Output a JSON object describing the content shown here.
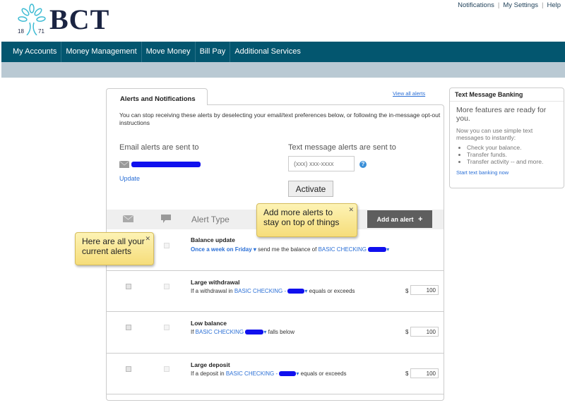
{
  "header": {
    "brand": "BCT",
    "logo_years": [
      "18",
      "71"
    ],
    "top_links": [
      "Notifications",
      "My Settings",
      "Help"
    ]
  },
  "nav": [
    "My Accounts",
    "Money Management",
    "Move Money",
    "Bill Pay",
    "Additional Services"
  ],
  "main": {
    "tab": "Alerts and Notifications",
    "view_all": "View all alerts",
    "intro": "You can stop receiving these alerts by deselecting your email/text preferences below, or following the in-message opt-out instructions",
    "email_label": "Email alerts are sent to",
    "update": "Update",
    "text_label": "Text message alerts are sent to",
    "phone_placeholder": "(xxx) xxx-xxxx",
    "activate": "Activate",
    "alert_type": "Alert Type",
    "add_alert": "Add an alert",
    "tip_add": "Add more alerts to stay on top of things",
    "tip_current": "Here are all your current alerts",
    "rows": [
      {
        "title": "Balance update",
        "freq": "Once a week on Friday ▾",
        "mid": " send me the balance of ",
        "acct": "BASIC CHECKING"
      },
      {
        "title": "Large withdrawal",
        "pre": "If a withdrawal in ",
        "acct": "BASIC CHECKING -",
        "post": " equals or exceeds",
        "currency": "$",
        "amount": "100"
      },
      {
        "title": "Low balance",
        "pre": "If ",
        "acct": "BASIC CHECKING",
        "post": " falls below",
        "currency": "$",
        "amount": "100"
      },
      {
        "title": "Large deposit",
        "pre": "If a deposit in ",
        "acct": "BASIC CHECKING -",
        "post": " equals or exceeds",
        "currency": "$",
        "amount": "100"
      }
    ]
  },
  "side": {
    "title": "Text Message Banking",
    "lead": "More features are ready for you.",
    "body": "Now you can use simple text messages to instantly:",
    "bullets": [
      "Check your balance.",
      "Transfer funds.",
      "Transfer activity -- and more."
    ],
    "link": "Start text banking now"
  },
  "colors": {
    "nav": "#03566f",
    "band": "#b9c9d3",
    "link": "#2a6fd6",
    "brand": "#1b2442",
    "logo": "#3fbcd4"
  }
}
